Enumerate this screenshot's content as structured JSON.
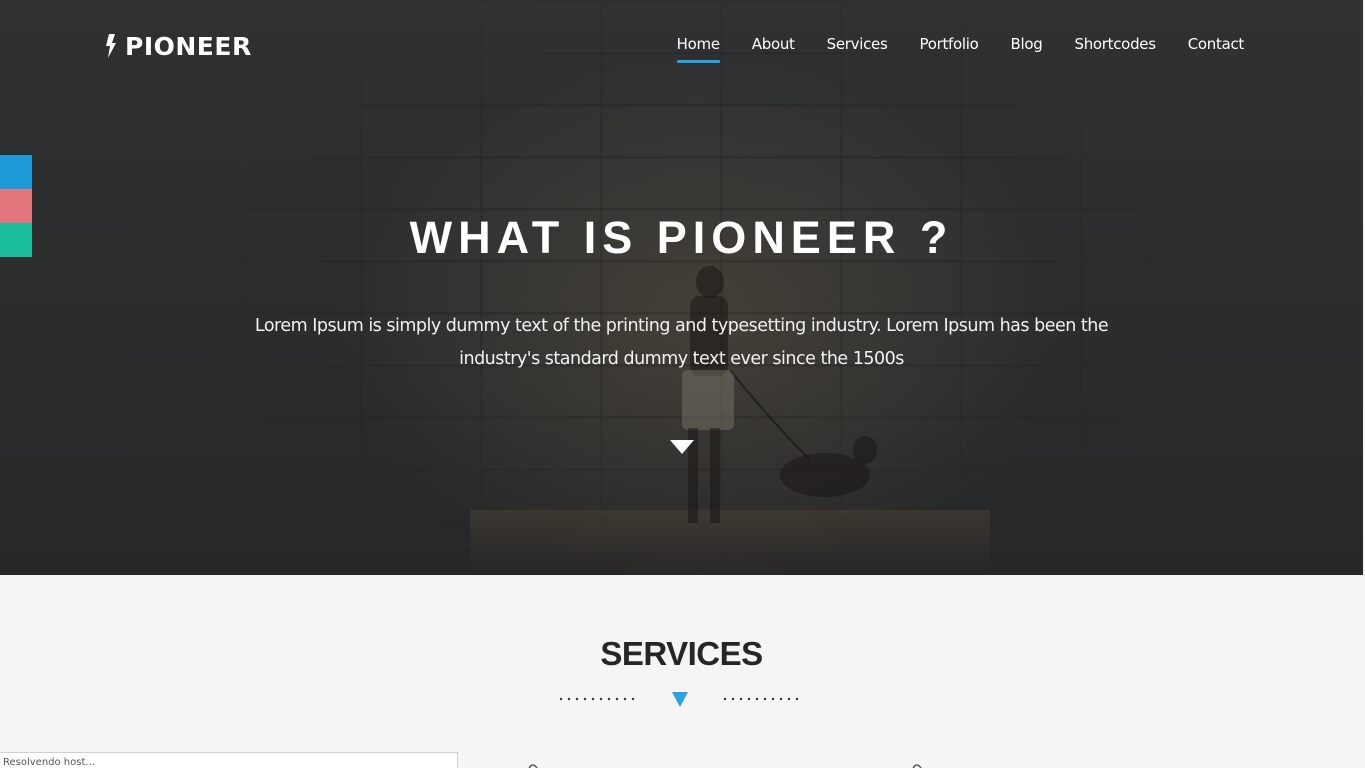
{
  "brand": {
    "name": "PIONEER"
  },
  "nav": {
    "items": [
      {
        "label": "Home",
        "active": true
      },
      {
        "label": "About",
        "active": false
      },
      {
        "label": "Services",
        "active": false
      },
      {
        "label": "Portfolio",
        "active": false
      },
      {
        "label": "Blog",
        "active": false
      },
      {
        "label": "Shortcodes",
        "active": false
      },
      {
        "label": "Contact",
        "active": false
      }
    ]
  },
  "theme_switcher": {
    "colors": [
      "#1f9ad9",
      "#e3767d",
      "#1bbc9b"
    ]
  },
  "hero": {
    "title": "WHAT IS PIONEER ?",
    "text": "Lorem Ipsum is simply dummy text of the printing and typesetting industry. Lorem Ipsum has been the industry's standard dummy text ever since the 1500s",
    "scroll_icon": "triangle-down-icon"
  },
  "services": {
    "title": "SERVICES",
    "divider_icon": "triangle-down-icon"
  },
  "status_bar": {
    "text": "Resolvendo host..."
  },
  "colors": {
    "accent": "#2aa3e0",
    "hero_bg": "#2c2e2f",
    "section_bg": "#f6f5f6"
  }
}
